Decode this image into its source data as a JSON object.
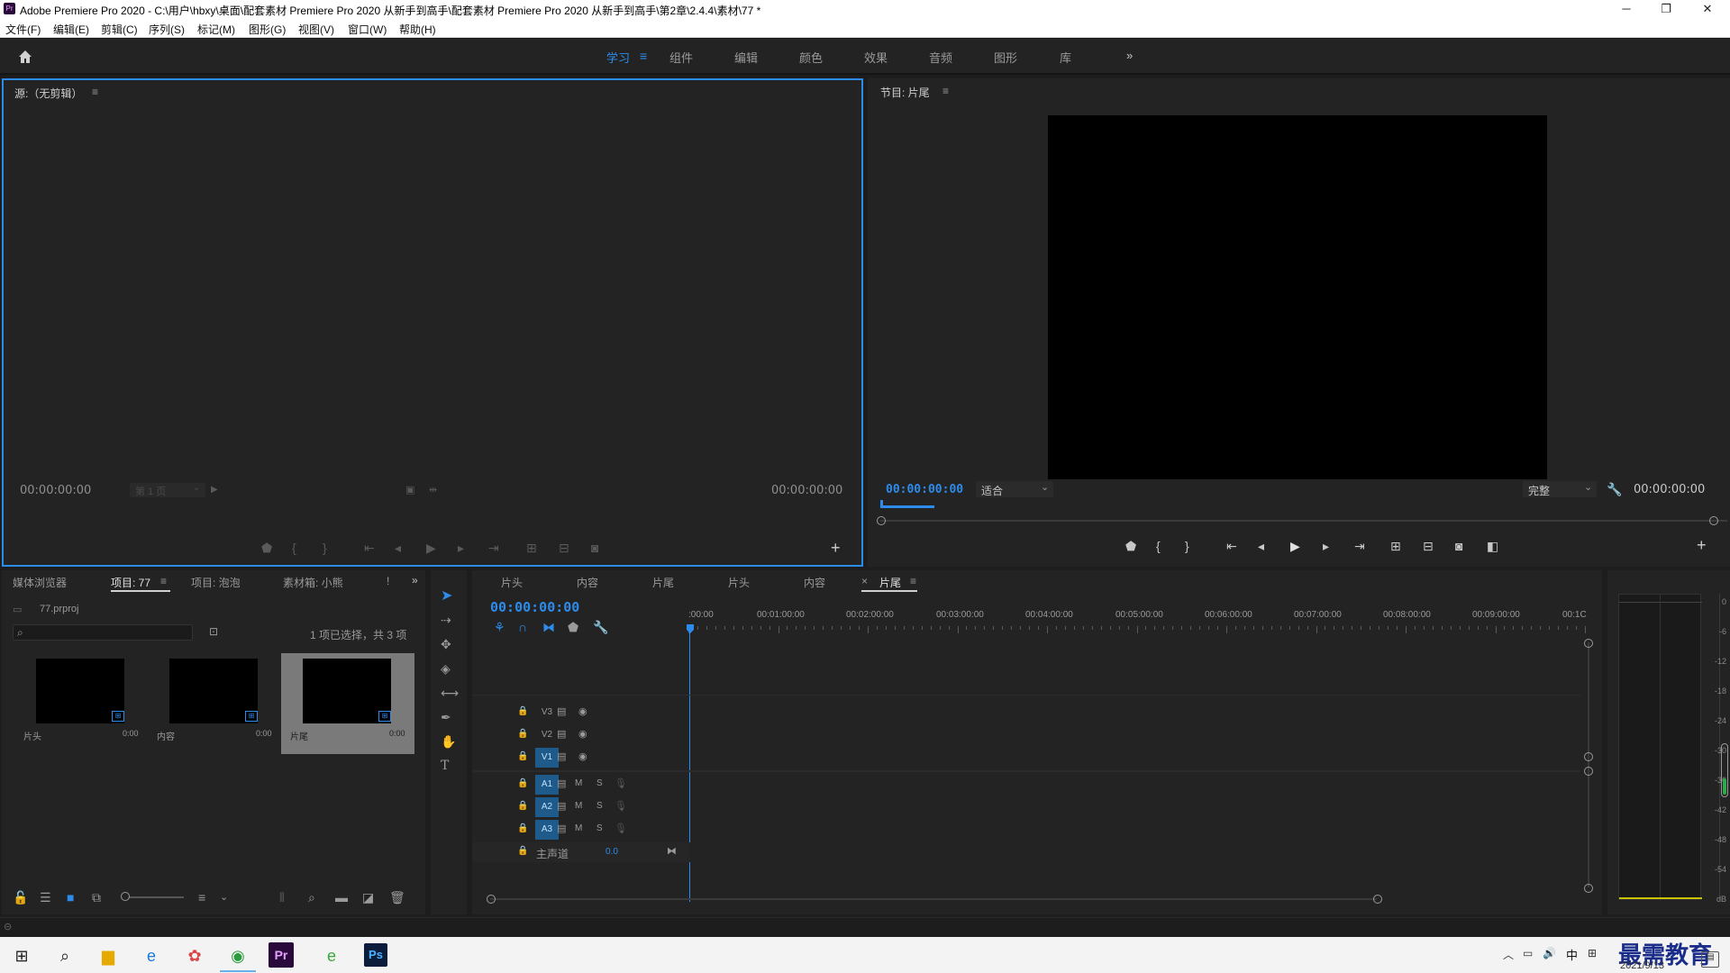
{
  "window": {
    "title": "Adobe Premiere Pro 2020 - C:\\用户\\hbxy\\桌面\\配套素材 Premiere Pro 2020 从新手到高手\\配套素材 Premiere Pro 2020 从新手到高手\\第2章\\2.4.4\\素材\\77 *",
    "logo": "Pr"
  },
  "menu": [
    "文件(F)",
    "编辑(E)",
    "剪辑(C)",
    "序列(S)",
    "标记(M)",
    "图形(G)",
    "视图(V)",
    "窗口(W)",
    "帮助(H)"
  ],
  "workspaces": {
    "tabs": [
      "学习",
      "组件",
      "编辑",
      "颜色",
      "效果",
      "音频",
      "图形",
      "库"
    ],
    "active": "学习",
    "more": "»"
  },
  "source": {
    "title": "源:（无剪辑）",
    "menu": "≡",
    "tc_left": "00:00:00:00",
    "page": "第 1 页",
    "tc_right": "00:00:00:00"
  },
  "program": {
    "title": "节目: 片尾",
    "menu": "≡",
    "tc_left": "00:00:00:00",
    "zoom": "适合",
    "quality": "完整",
    "tc_right": "00:00:00:00"
  },
  "project": {
    "tabs": [
      "媒体浏览器",
      "项目: 77",
      "项目: 泡泡",
      "素材箱: 小熊"
    ],
    "active_tab": "项目: 77",
    "more": "»",
    "file": "77.prproj",
    "status": "1 项已选择，共 3 项",
    "items": [
      {
        "name": "片头",
        "dur": "0:00"
      },
      {
        "name": "内容",
        "dur": "0:00"
      },
      {
        "name": "片尾",
        "dur": "0:00"
      }
    ]
  },
  "timeline": {
    "seq_tabs": [
      "片头",
      "内容",
      "片尾",
      "片头",
      "内容",
      "片尾"
    ],
    "active_tab": "片尾",
    "close": "×",
    "timecode": "00:00:00:00",
    "ruler": [
      ":00:00",
      "00:01:00:00",
      "00:02:00:00",
      "00:03:00:00",
      "00:04:00:00",
      "00:05:00:00",
      "00:06:00:00",
      "00:07:00:00",
      "00:08:00:00",
      "00:09:00:00",
      "00:1C"
    ],
    "video_tracks": [
      "V3",
      "V2",
      "V1"
    ],
    "audio_tracks": [
      "A1",
      "A2",
      "A3"
    ],
    "master": "主声道",
    "master_val": "0.0",
    "m": "M",
    "s": "S"
  },
  "meter": {
    "scale": [
      "0",
      "-6",
      "-12",
      "-18",
      "-24",
      "-30",
      "-36",
      "-42",
      "-48",
      "-54",
      "dB"
    ]
  },
  "taskbar": {
    "date": "2021/9/13",
    "ime": "中",
    "watermark": "最需教育"
  }
}
